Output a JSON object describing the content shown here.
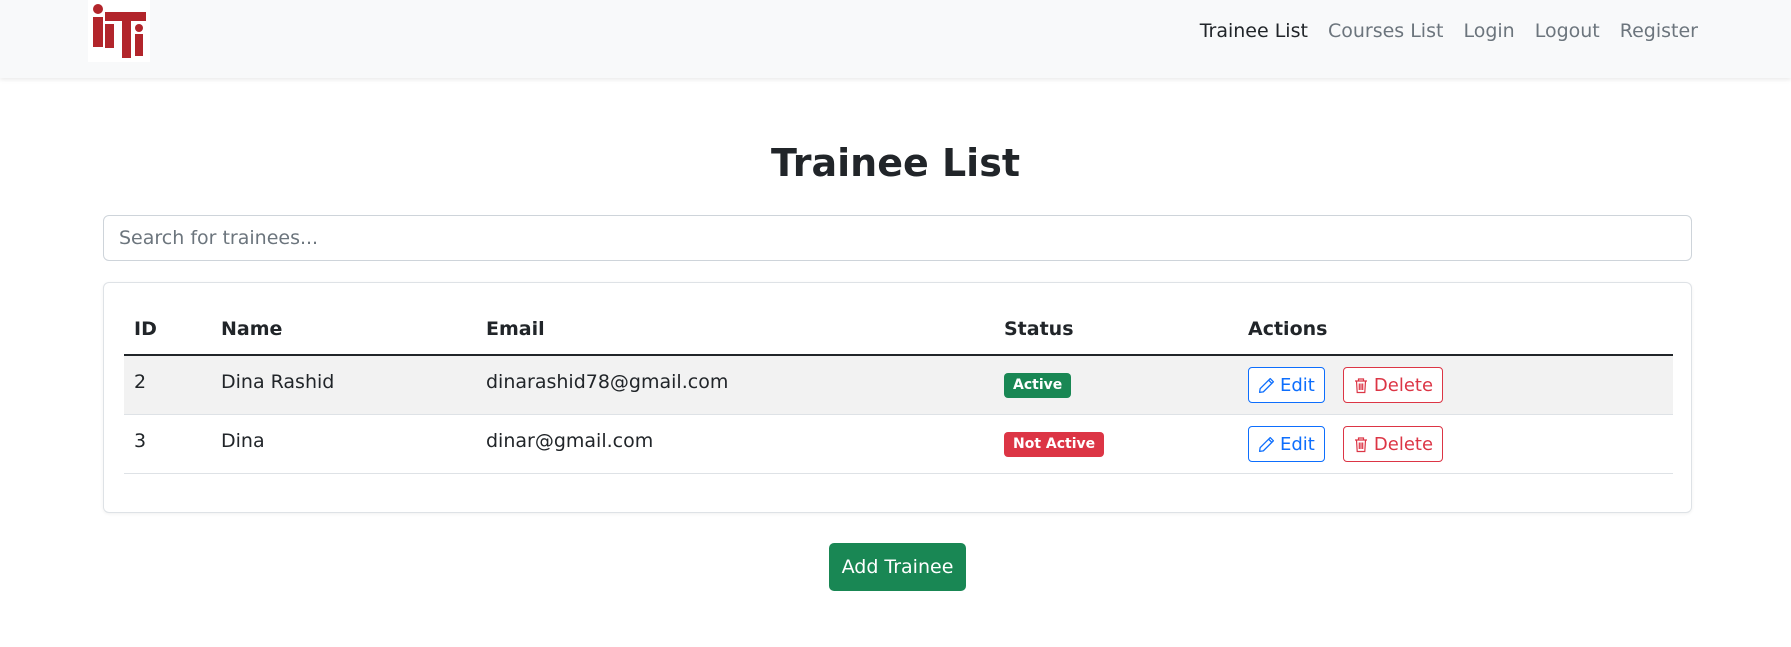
{
  "nav": {
    "links": [
      "Trainee List",
      "Courses List",
      "Login",
      "Logout",
      "Register"
    ],
    "active": "Trainee List"
  },
  "page": {
    "title": "Trainee List"
  },
  "search": {
    "placeholder": "Search for trainees...",
    "value": ""
  },
  "table": {
    "columns": [
      "ID",
      "Name",
      "Email",
      "Status",
      "Actions"
    ],
    "rows": [
      {
        "id": "2",
        "name": "Dina Rashid",
        "email": "dinarashid78@gmail.com",
        "status": "Active",
        "status_color": "#198754",
        "edit_label": "Edit",
        "delete_label": "Delete"
      },
      {
        "id": "3",
        "name": "Dina",
        "email": "dinar@gmail.com",
        "status": "Not Active",
        "status_color": "#dc3545",
        "edit_label": "Edit",
        "delete_label": "Delete"
      }
    ]
  },
  "add_button": {
    "label": "Add Trainee"
  },
  "colors": {
    "brand": "#b2252b",
    "primary": "#0d6efd",
    "success": "#198754",
    "danger": "#dc3545"
  },
  "icons": {
    "edit": "pencil-icon",
    "delete": "trash-icon"
  }
}
